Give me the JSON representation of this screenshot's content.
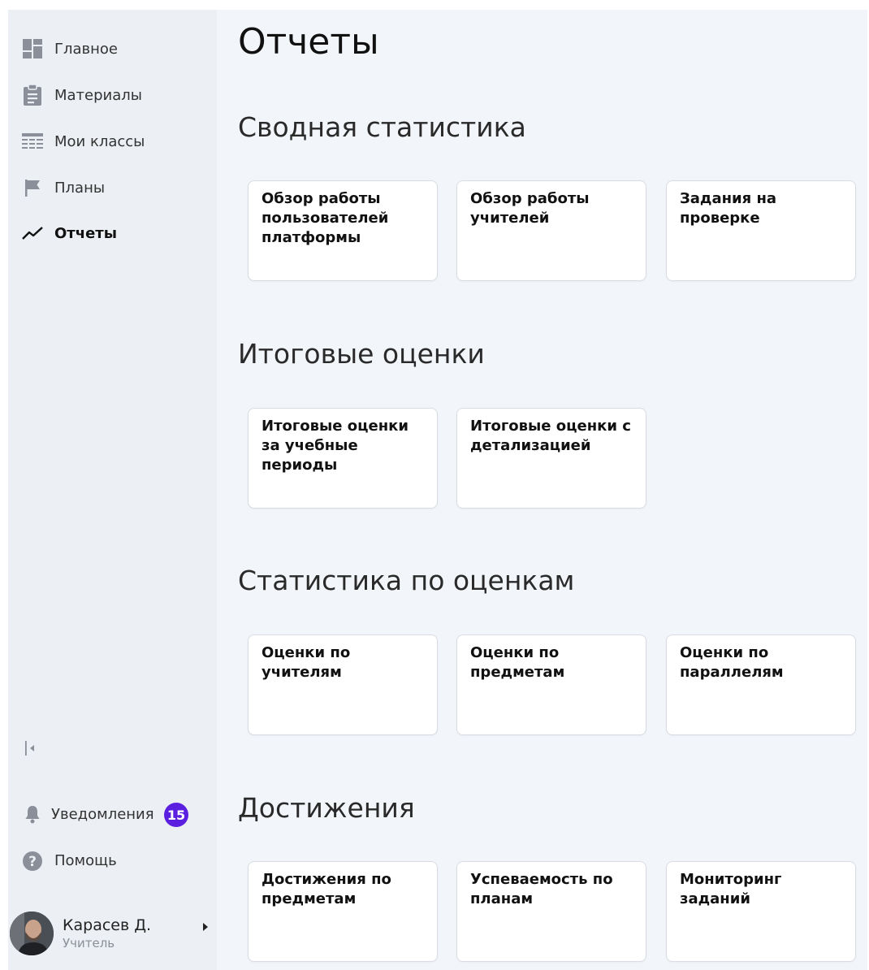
{
  "sidebar": {
    "items": [
      {
        "label": "Главное",
        "icon": "dashboard-icon",
        "active": false
      },
      {
        "label": "Материалы",
        "icon": "clipboard-icon",
        "active": false
      },
      {
        "label": "Мои классы",
        "icon": "table-icon",
        "active": false
      },
      {
        "label": "Планы",
        "icon": "flag-icon",
        "active": false
      },
      {
        "label": "Отчеты",
        "icon": "trend-line-icon",
        "active": true
      }
    ],
    "collapse_icon": "collapse-sidebar-icon",
    "notifications": {
      "label": "Уведомления",
      "count": "15",
      "icon": "bell-icon"
    },
    "help": {
      "label": "Помощь",
      "icon": "help-icon"
    },
    "user": {
      "name": "Карасев Д.",
      "role": "Учитель"
    }
  },
  "main": {
    "title": "Отчеты",
    "sections": [
      {
        "title": "Сводная статистика",
        "cards": [
          "Обзор работы пользователей платформы",
          "Обзор работы учителей",
          "Задания на проверке"
        ]
      },
      {
        "title": "Итоговые оценки",
        "cards": [
          "Итоговые оценки за учебные периоды",
          "Итоговые оценки с детализацией"
        ]
      },
      {
        "title": "Статистика по оценкам",
        "cards": [
          "Оценки по учителям",
          "Оценки по предметам",
          "Оценки по параллелям"
        ]
      },
      {
        "title": "Достижения",
        "cards": [
          "Достижения по предметам",
          "Успеваемость по планам",
          "Мониторинг заданий"
        ]
      }
    ]
  },
  "colors": {
    "badge": "#5b1fe0",
    "sidebar_bg": "#eceff4",
    "content_bg": "#f2f5fa"
  }
}
